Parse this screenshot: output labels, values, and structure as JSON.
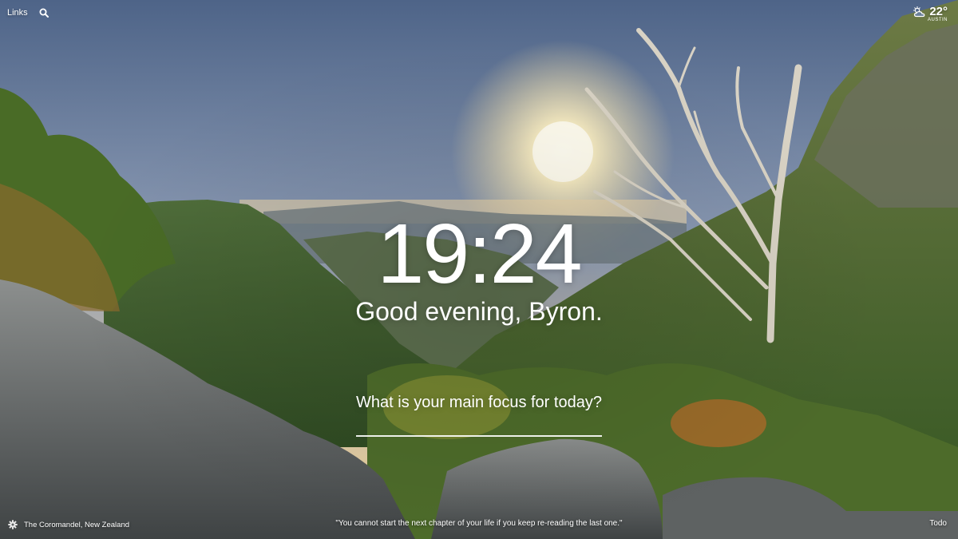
{
  "top_left": {
    "links_label": "Links",
    "search_icon": "search-icon"
  },
  "weather": {
    "icon": "partly-cloudy-sun-icon",
    "temperature": "22°",
    "location": "AUSTIN"
  },
  "clock": {
    "time": "19:24"
  },
  "greeting": {
    "text": "Good evening, Byron."
  },
  "focus": {
    "question": "What is your main focus for today?",
    "value": "",
    "placeholder": ""
  },
  "bottom": {
    "settings_icon": "gear-icon",
    "photo_location": "The Coromandel, New Zealand",
    "quote": "\"You cannot start the next chapter of your life if you keep re-reading the last one.\"",
    "todo_label": "Todo"
  },
  "colors": {
    "sky_top": "#5a6f92",
    "sky_horizon": "#e8c08a",
    "sun": "#fff6d8",
    "foliage": "#3f6a2a",
    "rock": "#5b5f60"
  }
}
